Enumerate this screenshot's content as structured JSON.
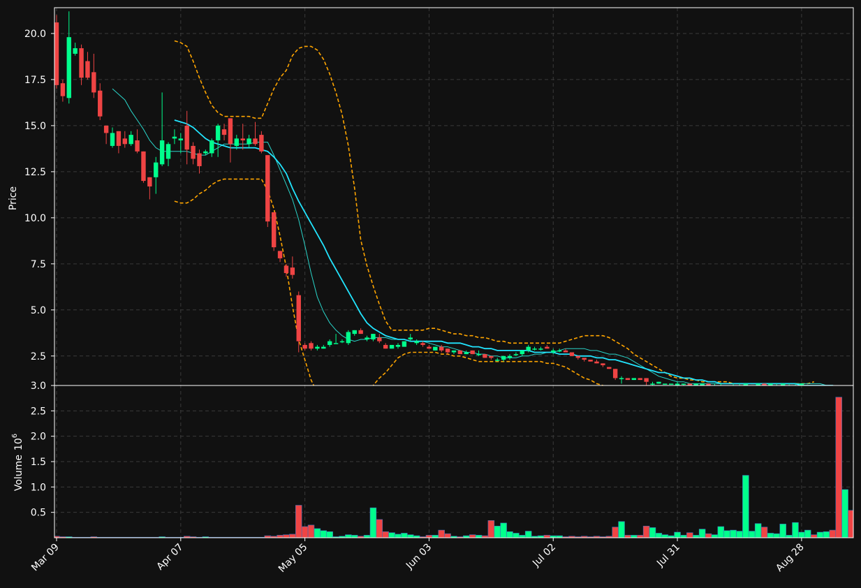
{
  "colors": {
    "background": "#111111",
    "grid": "#3a3a3a",
    "frame": "#ffffff",
    "up": "#00ff8c",
    "down": "#ef4444",
    "ma_long": "#22e5ff",
    "ma_short": "#2ad4c9",
    "bands": "#ffa500"
  },
  "chart_data": {
    "type": "candlestick",
    "price_axis": {
      "label": "Price",
      "ylim": [
        0.9,
        21.4
      ],
      "ticks": [
        "2.5",
        "5.0",
        "7.5",
        "10.0",
        "12.5",
        "15.0",
        "17.5",
        "20.0"
      ],
      "tick_values": [
        2.5,
        5.0,
        7.5,
        10.0,
        12.5,
        15.0,
        17.5,
        20.0
      ]
    },
    "volume_axis": {
      "label": "Volume",
      "exponent": "6",
      "ylim": [
        0,
        3.0
      ],
      "ticks": [
        "0.5",
        "1.0",
        "1.5",
        "2.0",
        "2.5",
        "3.0"
      ],
      "tick_values": [
        0.5,
        1.0,
        1.5,
        2.0,
        2.5,
        3.0
      ]
    },
    "x_ticks": [
      {
        "label": "Mar 09",
        "index": 0
      },
      {
        "label": "Apr 07",
        "index": 20
      },
      {
        "label": "May 05",
        "index": 40
      },
      {
        "label": "Jun 03",
        "index": 60
      },
      {
        "label": "Jul 02",
        "index": 80
      },
      {
        "label": "Jul 31",
        "index": 100
      },
      {
        "label": "Aug 28",
        "index": 120
      }
    ],
    "grid": true,
    "candles": [
      [
        20.6,
        21.0,
        17.0,
        17.2,
        0.03
      ],
      [
        17.3,
        17.5,
        16.3,
        16.6,
        0.02
      ],
      [
        16.5,
        21.2,
        16.2,
        19.8,
        0.02
      ],
      [
        18.9,
        19.5,
        18.8,
        19.2,
        0.01
      ],
      [
        19.2,
        19.4,
        17.2,
        17.6,
        0.01
      ],
      [
        18.5,
        19.0,
        17.5,
        17.6,
        0.01
      ],
      [
        17.9,
        18.9,
        16.5,
        16.8,
        0.02
      ],
      [
        16.9,
        17.3,
        15.3,
        15.5,
        0.01
      ],
      [
        15.0,
        15.0,
        14.0,
        14.6,
        0.01
      ],
      [
        13.9,
        14.9,
        13.8,
        14.6,
        0.01
      ],
      [
        14.7,
        14.7,
        13.5,
        13.9,
        0.01
      ],
      [
        14.3,
        14.7,
        13.8,
        14.0,
        0.01
      ],
      [
        14.0,
        14.7,
        13.9,
        14.5,
        0.01
      ],
      [
        14.2,
        14.8,
        13.5,
        13.6,
        0.01
      ],
      [
        13.6,
        13.6,
        11.9,
        12.0,
        0.01
      ],
      [
        12.2,
        12.2,
        11.0,
        11.7,
        0.01
      ],
      [
        12.2,
        13.3,
        11.3,
        13.0,
        0.01
      ],
      [
        12.9,
        16.8,
        12.8,
        14.2,
        0.02
      ],
      [
        13.2,
        14.1,
        12.8,
        14.0,
        0.01
      ],
      [
        14.3,
        14.8,
        14.0,
        14.4,
        0.01
      ],
      [
        14.2,
        14.6,
        13.5,
        14.3,
        0.01
      ],
      [
        15.0,
        15.8,
        12.9,
        13.7,
        0.03
      ],
      [
        13.9,
        14.1,
        12.9,
        13.2,
        0.02
      ],
      [
        13.5,
        13.7,
        12.4,
        12.8,
        0.01
      ],
      [
        13.5,
        13.7,
        13.4,
        13.6,
        0.02
      ],
      [
        13.5,
        14.3,
        13.3,
        14.2,
        0.01
      ],
      [
        14.2,
        15.1,
        13.3,
        15.0,
        0.01
      ],
      [
        14.8,
        15.1,
        14.2,
        14.5,
        0.01
      ],
      [
        15.4,
        15.4,
        13.0,
        14.0,
        0.01
      ],
      [
        13.9,
        14.5,
        13.7,
        14.3,
        0.01
      ],
      [
        14.3,
        15.1,
        13.7,
        14.2,
        0.01
      ],
      [
        14.0,
        14.5,
        13.8,
        14.3,
        0.01
      ],
      [
        14.3,
        15.2,
        13.9,
        14.0,
        0.01
      ],
      [
        14.5,
        14.7,
        13.5,
        13.6,
        0.01
      ],
      [
        13.4,
        13.4,
        9.5,
        9.8,
        0.04
      ],
      [
        10.3,
        10.3,
        8.2,
        8.4,
        0.03
      ],
      [
        8.2,
        8.2,
        7.6,
        7.8,
        0.05
      ],
      [
        7.4,
        7.5,
        6.8,
        7.0,
        0.06
      ],
      [
        7.3,
        7.9,
        6.7,
        6.9,
        0.07
      ],
      [
        5.8,
        6.0,
        2.7,
        3.3,
        0.64
      ],
      [
        3.1,
        3.2,
        2.8,
        2.9,
        0.22
      ],
      [
        3.2,
        3.3,
        2.8,
        2.9,
        0.25
      ],
      [
        2.9,
        3.1,
        2.8,
        3.0,
        0.18
      ],
      [
        2.9,
        3.1,
        2.9,
        3.0,
        0.14
      ],
      [
        3.1,
        3.4,
        3.0,
        3.3,
        0.12
      ],
      [
        3.2,
        3.7,
        3.2,
        3.2,
        0.02
      ],
      [
        3.3,
        3.4,
        3.2,
        3.3,
        0.03
      ],
      [
        3.2,
        3.9,
        3.1,
        3.8,
        0.06
      ],
      [
        3.7,
        3.9,
        3.6,
        3.9,
        0.05
      ],
      [
        3.9,
        4.0,
        3.7,
        3.7,
        0.03
      ],
      [
        3.4,
        3.6,
        3.3,
        3.5,
        0.05
      ],
      [
        3.4,
        3.7,
        3.3,
        3.7,
        0.59
      ],
      [
        3.5,
        3.7,
        3.2,
        3.3,
        0.36
      ],
      [
        3.1,
        3.2,
        2.9,
        2.9,
        0.12
      ],
      [
        2.9,
        3.1,
        2.9,
        3.1,
        0.1
      ],
      [
        3.0,
        3.2,
        2.9,
        3.1,
        0.07
      ],
      [
        3.0,
        3.3,
        3.0,
        3.3,
        0.09
      ],
      [
        3.4,
        3.7,
        3.3,
        3.5,
        0.06
      ],
      [
        3.2,
        3.4,
        3.1,
        3.3,
        0.04
      ],
      [
        3.2,
        3.3,
        3.0,
        3.1,
        0.02
      ],
      [
        3.0,
        3.1,
        2.9,
        2.9,
        0.05
      ],
      [
        2.8,
        3.0,
        2.8,
        3.0,
        0.05
      ],
      [
        3.0,
        3.1,
        2.7,
        2.8,
        0.15
      ],
      [
        2.9,
        2.9,
        2.6,
        2.7,
        0.08
      ],
      [
        2.7,
        2.8,
        2.6,
        2.8,
        0.03
      ],
      [
        2.8,
        2.8,
        2.6,
        2.6,
        0.02
      ],
      [
        2.6,
        2.8,
        2.6,
        2.7,
        0.04
      ],
      [
        2.8,
        2.8,
        2.6,
        2.6,
        0.06
      ],
      [
        2.6,
        2.8,
        2.5,
        2.6,
        0.05
      ],
      [
        2.6,
        2.6,
        2.4,
        2.4,
        0.04
      ],
      [
        2.5,
        2.5,
        2.3,
        2.4,
        0.34
      ],
      [
        2.3,
        2.4,
        2.2,
        2.3,
        0.23
      ],
      [
        2.3,
        2.5,
        2.2,
        2.5,
        0.29
      ],
      [
        2.4,
        2.6,
        2.3,
        2.5,
        0.12
      ],
      [
        2.6,
        2.7,
        2.5,
        2.6,
        0.09
      ],
      [
        2.6,
        2.8,
        2.5,
        2.8,
        0.05
      ],
      [
        2.8,
        3.1,
        2.7,
        3.0,
        0.13
      ],
      [
        2.9,
        3.0,
        2.8,
        2.9,
        0.03
      ],
      [
        2.9,
        3.0,
        2.8,
        2.9,
        0.04
      ],
      [
        3.0,
        3.1,
        2.9,
        2.9,
        0.05
      ],
      [
        2.7,
        2.9,
        2.6,
        2.8,
        0.04
      ],
      [
        2.8,
        2.9,
        2.7,
        2.8,
        0.04
      ],
      [
        2.8,
        2.9,
        2.7,
        2.7,
        0.02
      ],
      [
        2.7,
        2.7,
        2.5,
        2.5,
        0.03
      ],
      [
        2.5,
        2.5,
        2.3,
        2.4,
        0.02
      ],
      [
        2.4,
        2.4,
        2.2,
        2.3,
        0.03
      ],
      [
        2.3,
        2.3,
        2.2,
        2.2,
        0.02
      ],
      [
        2.2,
        2.3,
        2.1,
        2.1,
        0.03
      ],
      [
        2.1,
        2.1,
        1.9,
        2.0,
        0.02
      ],
      [
        1.9,
        1.9,
        1.8,
        1.8,
        0.03
      ],
      [
        1.8,
        1.8,
        1.2,
        1.3,
        0.21
      ],
      [
        1.3,
        1.4,
        1.0,
        1.3,
        0.32
      ],
      [
        1.3,
        1.3,
        1.2,
        1.2,
        0.05
      ],
      [
        1.2,
        1.3,
        1.2,
        1.3,
        0.05
      ],
      [
        1.3,
        1.3,
        1.2,
        1.2,
        0.05
      ],
      [
        1.3,
        1.3,
        0.9,
        1.1,
        0.23
      ],
      [
        1.0,
        1.1,
        0.9,
        1.0,
        0.2
      ],
      [
        1.0,
        1.1,
        1.0,
        1.1,
        0.09
      ],
      [
        1.0,
        1.0,
        1.0,
        1.0,
        0.06
      ],
      [
        1.0,
        1.0,
        1.0,
        1.0,
        0.04
      ],
      [
        0.9,
        1.1,
        0.9,
        1.0,
        0.11
      ],
      [
        1.0,
        1.0,
        0.9,
        1.0,
        0.05
      ],
      [
        1.0,
        1.0,
        0.9,
        0.9,
        0.1
      ],
      [
        0.9,
        1.0,
        0.9,
        1.0,
        0.05
      ],
      [
        0.9,
        1.0,
        0.9,
        1.0,
        0.17
      ],
      [
        1.0,
        1.0,
        0.9,
        0.9,
        0.08
      ],
      [
        0.9,
        1.0,
        0.9,
        0.9,
        0.06
      ],
      [
        0.9,
        1.0,
        0.9,
        0.9,
        0.22
      ],
      [
        0.9,
        0.9,
        0.9,
        0.9,
        0.14
      ],
      [
        0.9,
        1.0,
        0.9,
        0.9,
        0.15
      ],
      [
        0.9,
        1.0,
        0.9,
        0.9,
        0.13
      ],
      [
        0.9,
        1.0,
        0.9,
        1.0,
        1.23
      ],
      [
        0.9,
        0.9,
        0.9,
        0.9,
        0.13
      ],
      [
        0.9,
        1.0,
        0.9,
        1.0,
        0.28
      ],
      [
        1.0,
        1.0,
        0.9,
        0.9,
        0.21
      ],
      [
        0.9,
        1.0,
        0.9,
        1.0,
        0.09
      ],
      [
        0.9,
        1.0,
        0.9,
        0.9,
        0.08
      ],
      [
        0.9,
        1.0,
        0.9,
        1.0,
        0.27
      ],
      [
        0.9,
        1.0,
        0.9,
        0.9,
        0.05
      ],
      [
        0.9,
        1.0,
        0.9,
        0.9,
        0.3
      ],
      [
        0.9,
        1.0,
        0.9,
        1.0,
        0.11
      ],
      [
        0.9,
        0.9,
        0.8,
        0.9,
        0.15
      ],
      [
        0.9,
        0.9,
        0.8,
        0.8,
        0.06
      ],
      [
        0.8,
        0.9,
        0.8,
        0.8,
        0.11
      ],
      [
        0.8,
        0.9,
        0.8,
        0.8,
        0.12
      ],
      [
        0.8,
        0.8,
        0.7,
        0.7,
        0.15
      ],
      [
        0.6,
        0.7,
        0.4,
        0.5,
        2.77
      ],
      [
        0.5,
        0.6,
        0.4,
        0.5,
        0.95
      ],
      [
        0.5,
        0.6,
        0.4,
        0.4,
        0.54
      ]
    ],
    "ma_long_start": 19,
    "ma_long": [
      15.3,
      15.2,
      15.1,
      14.9,
      14.6,
      14.3,
      14.1,
      14.0,
      13.9,
      13.8,
      13.8,
      13.8,
      13.8,
      13.8,
      13.7,
      13.6,
      13.3,
      12.9,
      12.4,
      11.6,
      10.9,
      10.3,
      9.7,
      9.1,
      8.5,
      7.8,
      7.2,
      6.6,
      6.0,
      5.4,
      4.8,
      4.3,
      4.0,
      3.8,
      3.6,
      3.5,
      3.4,
      3.4,
      3.3,
      3.3,
      3.3,
      3.3,
      3.3,
      3.3,
      3.2,
      3.2,
      3.2,
      3.1,
      3.0,
      3.0,
      2.9,
      2.9,
      2.8,
      2.8,
      2.8,
      2.8,
      2.8,
      2.8,
      2.7,
      2.7,
      2.7,
      2.7,
      2.6,
      2.6,
      2.6,
      2.5,
      2.5,
      2.5,
      2.4,
      2.4,
      2.3,
      2.3,
      2.2,
      2.1,
      2.0,
      1.9,
      1.8,
      1.7,
      1.6,
      1.6,
      1.5,
      1.4,
      1.3,
      1.3,
      1.2,
      1.2,
      1.1,
      1.1,
      1.0,
      1.0,
      1.0,
      1.0,
      1.0,
      1.0,
      1.0,
      1.0,
      1.0,
      1.0,
      1.0,
      1.0,
      1.0,
      0.9,
      0.9,
      0.9,
      0.9,
      0.9,
      0.9,
      0.8,
      0.8,
      0.8
    ],
    "ma_short_start": 9,
    "ma_short": [
      17.0,
      16.7,
      16.4,
      15.8,
      15.3,
      14.8,
      14.2,
      13.8,
      13.6,
      13.6,
      13.6,
      13.6,
      13.6,
      13.5,
      13.4,
      13.4,
      13.6,
      13.8,
      14.0,
      14.0,
      14.0,
      14.0,
      14.0,
      14.1,
      14.1,
      14.1,
      13.4,
      12.6,
      11.8,
      11.0,
      9.9,
      8.5,
      7.0,
      5.7,
      4.9,
      4.3,
      3.9,
      3.6,
      3.4,
      3.3,
      3.4,
      3.4,
      3.5,
      3.5,
      3.5,
      3.4,
      3.4,
      3.4,
      3.3,
      3.3,
      3.3,
      3.2,
      3.1,
      3.0,
      3.0,
      2.9,
      2.8,
      2.7,
      2.7,
      2.6,
      2.6,
      2.5,
      2.5,
      2.4,
      2.4,
      2.4,
      2.5,
      2.5,
      2.6,
      2.6,
      2.7,
      2.7,
      2.8,
      2.9,
      2.9,
      2.9,
      2.9,
      2.8,
      2.8,
      2.7,
      2.6,
      2.6,
      2.5,
      2.4,
      2.2,
      2.0,
      1.8,
      1.6,
      1.4,
      1.3,
      1.2,
      1.1,
      1.1,
      1.0,
      1.0,
      1.0,
      1.0,
      1.0,
      1.0,
      1.0,
      1.0,
      1.0,
      1.0,
      1.0,
      1.0,
      1.0,
      1.0,
      1.0,
      1.0,
      1.0,
      1.0,
      1.0,
      1.0,
      1.0,
      1.0,
      0.9,
      0.9,
      0.9,
      0.9,
      0.8
    ],
    "bands_start": 19,
    "band_upper": [
      19.6,
      19.5,
      19.3,
      18.5,
      17.6,
      16.8,
      16.1,
      15.7,
      15.5,
      15.5,
      15.5,
      15.5,
      15.5,
      15.4,
      15.4,
      16.2,
      17.0,
      17.6,
      18.0,
      18.8,
      19.2,
      19.3,
      19.3,
      19.1,
      18.6,
      17.8,
      16.8,
      15.6,
      13.9,
      11.6,
      8.8,
      7.4,
      6.3,
      5.3,
      4.4,
      3.9,
      3.9,
      3.9,
      3.9,
      3.9,
      3.9,
      4.0,
      4.0,
      3.9,
      3.8,
      3.7,
      3.7,
      3.6,
      3.6,
      3.5,
      3.5,
      3.4,
      3.3,
      3.3,
      3.2,
      3.2,
      3.2,
      3.2,
      3.2,
      3.2,
      3.2,
      3.2,
      3.2,
      3.3,
      3.4,
      3.5,
      3.6,
      3.6,
      3.6,
      3.6,
      3.5,
      3.3,
      3.1,
      2.9,
      2.6,
      2.4,
      2.2,
      2.0,
      1.8,
      1.6,
      1.4,
      1.3,
      1.3,
      1.2,
      1.2,
      1.1,
      1.1,
      1.1,
      1.1,
      1.1,
      1.0,
      1.0,
      1.0,
      1.0,
      1.0,
      1.0,
      1.0,
      1.0,
      1.0,
      1.0,
      1.0,
      1.0,
      1.0,
      1.1
    ],
    "band_lower": [
      10.9,
      10.8,
      10.8,
      11.0,
      11.3,
      11.5,
      11.8,
      12.0,
      12.1,
      12.1,
      12.1,
      12.1,
      12.1,
      12.1,
      12.1,
      11.5,
      10.5,
      9.0,
      7.3,
      5.2,
      3.4,
      2.3,
      1.2,
      0.5,
      0.4,
      0.6,
      0.7,
      0.6,
      0.6,
      0.5,
      0.5,
      0.7,
      0.9,
      1.3,
      1.6,
      2.0,
      2.4,
      2.6,
      2.7,
      2.7,
      2.7,
      2.7,
      2.7,
      2.6,
      2.6,
      2.5,
      2.5,
      2.4,
      2.3,
      2.2,
      2.2,
      2.2,
      2.2,
      2.2,
      2.2,
      2.2,
      2.2,
      2.2,
      2.2,
      2.2,
      2.1,
      2.1,
      2.0,
      1.9,
      1.7,
      1.5,
      1.3,
      1.2,
      1.0,
      0.9,
      0.8,
      0.8,
      0.8,
      0.8,
      0.8,
      0.8,
      0.8,
      0.8,
      0.8,
      0.8,
      0.8,
      0.8,
      0.8,
      0.8,
      0.8,
      0.8,
      0.8,
      0.8,
      0.8,
      0.8,
      0.8,
      0.8,
      0.8,
      0.8,
      0.8,
      0.8,
      0.8,
      0.8,
      0.8,
      0.8,
      0.8,
      0.8,
      0.7,
      0.6
    ]
  }
}
